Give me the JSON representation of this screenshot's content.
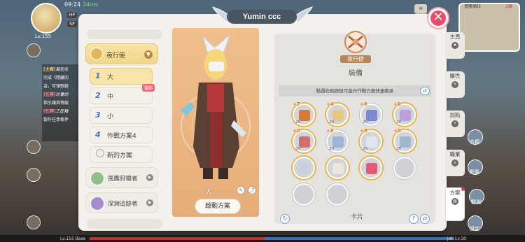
{
  "hud": {
    "time": "09:24",
    "latency": "34ms",
    "hp": "HP",
    "sp": "SP",
    "level": "Lv.155",
    "map_label": "普隆德拉",
    "map_level": "2級"
  },
  "chat": {
    "lines": [
      {
        "tag": "[主線]",
        "text": "幫別灰"
      },
      {
        "tag": "",
        "text": "完成《隱藏的"
      },
      {
        "tag": "",
        "text": "金，可領取經"
      },
      {
        "tag": "[任務]",
        "text": "珍貴的"
      },
      {
        "tag": "",
        "text": "指引讓其等級"
      },
      {
        "tag": "[任務]",
        "text": "工匠精"
      },
      {
        "tag": "",
        "text": "製作任意條件"
      }
    ]
  },
  "dialog": {
    "title": "Yumin ccc",
    "close_label": "✕"
  },
  "job": {
    "name": "夜行使",
    "emblem": "crossbow-emblem"
  },
  "plans": [
    {
      "num": "1",
      "label": "大",
      "active": true,
      "tag": ""
    },
    {
      "num": "2",
      "label": "中",
      "active": false,
      "tag": "當前"
    },
    {
      "num": "3",
      "label": "小",
      "active": false,
      "tag": ""
    },
    {
      "num": "4",
      "label": "作戰方案4",
      "active": false,
      "tag": ""
    }
  ],
  "new_plan_label": "新的方案",
  "other_jobs": [
    {
      "label": "風鷹狩獵者"
    },
    {
      "label": "深淵追跡者"
    }
  ],
  "character": {
    "plan_name": "大",
    "launch_label": "啟動方案"
  },
  "equipment": {
    "title": "裝備",
    "hint": "點選右側按鈕可進行作戰方案快速繼承",
    "slots": [
      {
        "refine": "+7",
        "level": "20",
        "color": "#d97a3a",
        "gold": true
      },
      {
        "refine": "+4",
        "level": "20",
        "color": "#e7c880",
        "gold": true
      },
      {
        "refine": "+8",
        "level": "20",
        "color": "#7b8ad0",
        "gold": false
      },
      {
        "refine": "+8",
        "level": "20",
        "color": "#bb9fd8",
        "gold": true
      },
      {
        "refine": "+8",
        "level": "20",
        "color": "#d06f6f",
        "gold": true
      },
      {
        "refine": "+8",
        "level": "20",
        "color": "#9fb4d8",
        "gold": false
      },
      {
        "refine": "+8",
        "level": "20",
        "color": "#e0e6f0",
        "gold": true
      },
      {
        "refine": "+8",
        "level": "20",
        "color": "#9fb7d0",
        "gold": true
      },
      {
        "refine": "",
        "level": "",
        "color": "#c8d0e0",
        "gold": true
      },
      {
        "refine": "",
        "level": "",
        "color": "#ece6dc",
        "gold": true
      },
      {
        "refine": "",
        "level": "",
        "color": "#e25c78",
        "gold": true
      },
      {
        "refine": "",
        "level": "",
        "color": "",
        "gold": false
      },
      {
        "refine": "",
        "level": "",
        "color": "",
        "gold": false
      },
      {
        "refine": "",
        "level": "",
        "color": "",
        "gold": false
      }
    ],
    "card_title": "卡片"
  },
  "tabs": [
    {
      "label": "主頁",
      "icon": "home-icon"
    },
    {
      "label": "屬性",
      "icon": "stats-icon"
    },
    {
      "label": "加點",
      "icon": "plus-icon"
    },
    {
      "label": "職業",
      "icon": "job-icon"
    },
    {
      "label": "方案",
      "icon": "plan-icon"
    }
  ],
  "right_icons": [
    {
      "label": "衣櫥"
    },
    {
      "label": "影裝"
    },
    {
      "label": "觀測"
    },
    {
      "label": "設定"
    }
  ],
  "bottom": {
    "left": "Lv.155 Base",
    "right": "Job Lv.30"
  }
}
